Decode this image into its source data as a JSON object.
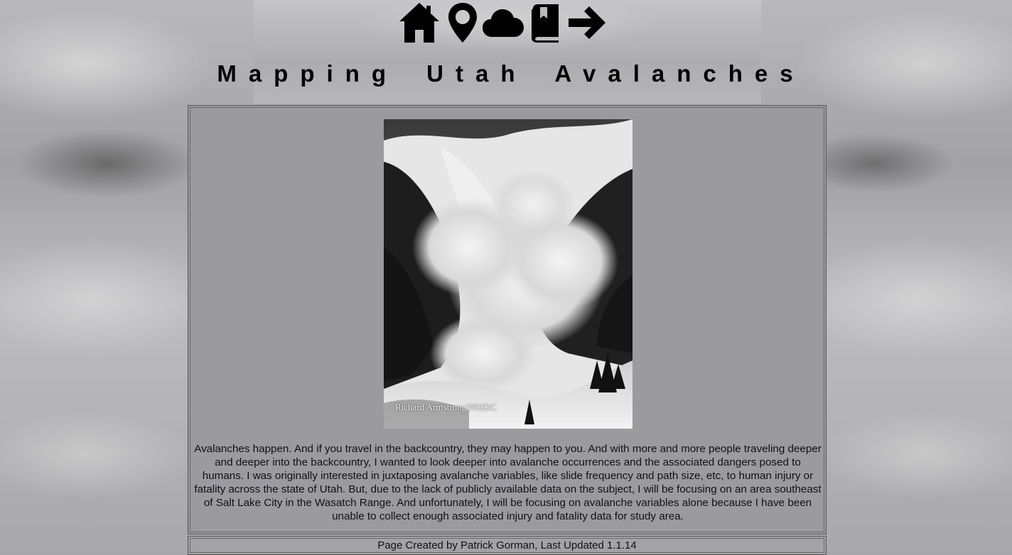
{
  "nav": {
    "icons": [
      {
        "name": "home-icon"
      },
      {
        "name": "map-pin-icon"
      },
      {
        "name": "cloud-icon"
      },
      {
        "name": "book-icon"
      },
      {
        "name": "arrow-right-icon"
      }
    ]
  },
  "page": {
    "title": "Mapping Utah Avalanches"
  },
  "hero": {
    "description": "black-and-white photo of avalanche powder cloud in forested mountain gully",
    "credit": "Richard Armstrong/NSIDC"
  },
  "intro": {
    "text": "Avalanches happen. And if you travel in the backcountry, they may happen to you. And with more and more people traveling deeper and deeper into the backcountry, I wanted to look deeper into avalanche occurrences and the associated dangers posed to humans.  I was originally interested in juxtaposing avalanche variables, like slide frequency and path size, etc, to human injury or fatality across the state of Utah. But, due to the lack of publicly available data on the subject, I will be focusing on an area southeast of Salt Lake City in the Wasatch Range. And unfortunately, I will be focusing on avalanche variables alone because I have been unable to collect enough associated injury and fatality data for study area."
  },
  "footer": {
    "text": "Page Created by Patrick Gorman, Last Updated 1.1.14"
  },
  "colors": {
    "content_background": "#9b9a9e",
    "text": "#111111",
    "icon": "#000000"
  }
}
